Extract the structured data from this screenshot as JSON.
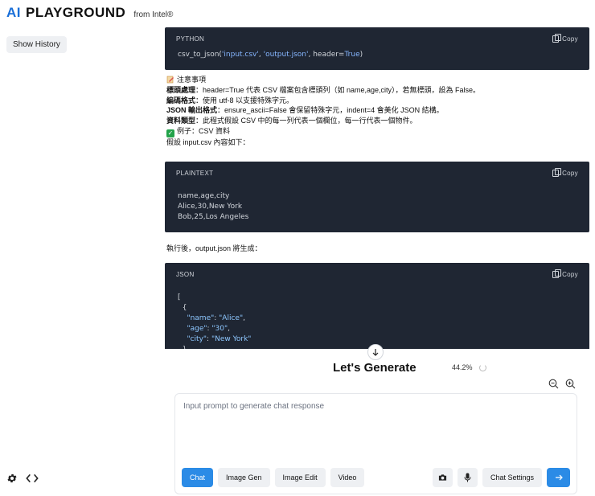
{
  "brand": {
    "ai": "AI",
    "playground": "PLAYGROUND",
    "from": "from Intel®"
  },
  "sidebar": {
    "show_history": "Show History"
  },
  "code1": {
    "lang": "PYTHON",
    "copy": "Copy"
  },
  "code2": {
    "lang": "PLAINTEXT",
    "copy": "Copy",
    "lines": [
      "name,age,city",
      "Alice,30,New York",
      "Bob,25,Los Angeles"
    ]
  },
  "code3": {
    "lang": "JSON",
    "copy": "Copy"
  },
  "notes": {
    "heading": "注意事項",
    "l1_label": "標頭處理",
    "l1_text": "：header=True 代表 CSV 檔案包含標頭列（如 name,age,city），若無標頭，設為 False。",
    "l2_label": "編碼格式",
    "l2_text": "：使用 utf-8 以支援特殊字元。",
    "l3_label": "JSON 輸出格式",
    "l3_text": "：ensure_ascii=False 會保留特殊字元，indent=4 會美化 JSON 結構。",
    "l4_label": "資料類型",
    "l4_text": "：此程式假設 CSV 中的每一列代表一個欄位，每一行代表一個物件。",
    "example": "例子：CSV 資料",
    "assume": "假設 input.csv 內容如下："
  },
  "after_text": "執行後，output.json 將生成：",
  "status": {
    "title": "Let's Generate",
    "progress": "44.2%"
  },
  "prompt": {
    "placeholder": "Input prompt to generate chat response"
  },
  "tabs": [
    {
      "label": "Chat"
    },
    {
      "label": "Image Gen"
    },
    {
      "label": "Image Edit"
    },
    {
      "label": "Video"
    }
  ],
  "actions": {
    "chat_settings": "Chat Settings"
  }
}
